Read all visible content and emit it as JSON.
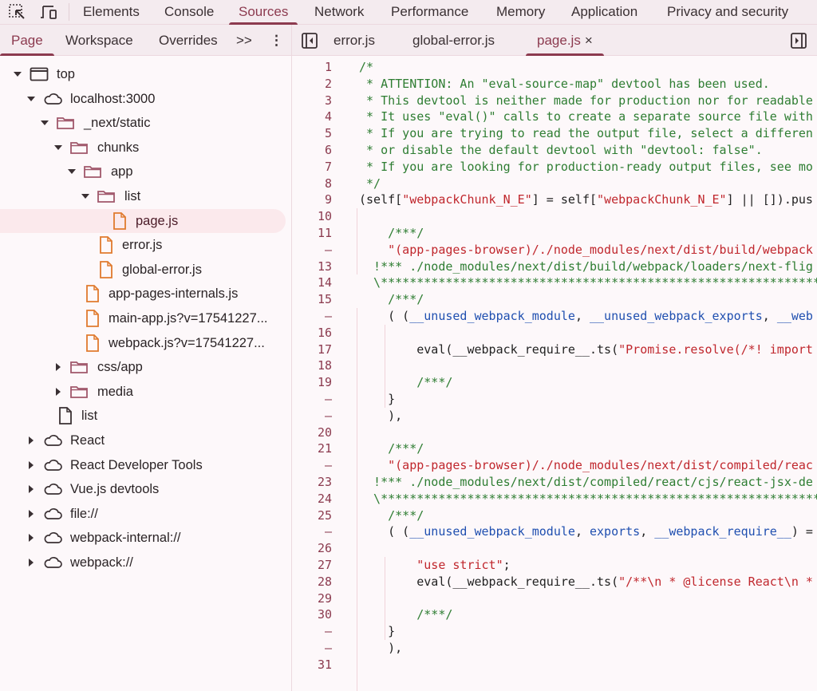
{
  "top_tabs": [
    "Elements",
    "Console",
    "Sources",
    "Network",
    "Performance",
    "Memory",
    "Application",
    "Privacy and security"
  ],
  "top_active": "Sources",
  "nav_tabs": [
    "Page",
    "Workspace",
    "Overrides"
  ],
  "nav_more": ">>",
  "nav_menu": "⋮",
  "editor_tabs": [
    {
      "label": "error.js"
    },
    {
      "label": "global-error.js"
    },
    {
      "label": "page.js",
      "active": true,
      "close": "×"
    }
  ],
  "colors": {
    "accent": "#8c3a4f",
    "comment": "#2e7d32",
    "string": "#c0272d",
    "identifier": "#1f4fb0",
    "folder": "#a0576b",
    "file": "#e07a2e"
  },
  "tree": [
    {
      "label": "top",
      "level": 0,
      "icon": "frame",
      "state": "open"
    },
    {
      "label": "localhost:3000",
      "level": 1,
      "icon": "cloud",
      "state": "open"
    },
    {
      "label": "_next/static",
      "level": 2,
      "icon": "folder",
      "state": "open"
    },
    {
      "label": "chunks",
      "level": 3,
      "icon": "folder",
      "state": "open"
    },
    {
      "label": "app",
      "level": 4,
      "icon": "folder",
      "state": "open"
    },
    {
      "label": "list",
      "level": 5,
      "icon": "folder",
      "state": "open"
    },
    {
      "label": "page.js",
      "level": 6,
      "icon": "file-js",
      "selected": true
    },
    {
      "label": "error.js",
      "level": 5,
      "icon": "file-js"
    },
    {
      "label": "global-error.js",
      "level": 5,
      "icon": "file-js"
    },
    {
      "label": "app-pages-internals.js",
      "level": 4,
      "icon": "file-js"
    },
    {
      "label": "main-app.js?v=17541227...",
      "level": 4,
      "icon": "file-js"
    },
    {
      "label": "webpack.js?v=17541227...",
      "level": 4,
      "icon": "file-js"
    },
    {
      "label": "css/app",
      "level": 3,
      "icon": "folder",
      "state": "closed"
    },
    {
      "label": "media",
      "level": 3,
      "icon": "folder",
      "state": "closed"
    },
    {
      "label": "list",
      "level": 2,
      "icon": "file"
    },
    {
      "label": "React",
      "level": 1,
      "icon": "cloud",
      "state": "closed"
    },
    {
      "label": "React Developer Tools",
      "level": 1,
      "icon": "cloud",
      "state": "closed"
    },
    {
      "label": "Vue.js devtools",
      "level": 1,
      "icon": "cloud",
      "state": "closed"
    },
    {
      "label": "file://",
      "level": 1,
      "icon": "cloud",
      "state": "closed"
    },
    {
      "label": "webpack-internal://",
      "level": 1,
      "icon": "cloud",
      "state": "closed"
    },
    {
      "label": "webpack://",
      "level": 1,
      "icon": "cloud",
      "state": "closed"
    }
  ],
  "code": [
    {
      "n": "1",
      "t": [
        [
          "c",
          "/*"
        ]
      ]
    },
    {
      "n": "2",
      "t": [
        [
          "c",
          " * ATTENTION: An \"eval-source-map\" devtool has been used."
        ]
      ]
    },
    {
      "n": "3",
      "t": [
        [
          "c",
          " * This devtool is neither made for production nor for readable"
        ]
      ]
    },
    {
      "n": "4",
      "t": [
        [
          "c",
          " * It uses \"eval()\" calls to create a separate source file with"
        ]
      ]
    },
    {
      "n": "5",
      "t": [
        [
          "c",
          " * If you are trying to read the output file, select a differen"
        ]
      ]
    },
    {
      "n": "6",
      "t": [
        [
          "c",
          " * or disable the default devtool with \"devtool: false\"."
        ]
      ]
    },
    {
      "n": "7",
      "t": [
        [
          "c",
          " * If you are looking for production-ready output files, see mo"
        ]
      ]
    },
    {
      "n": "8",
      "t": [
        [
          "c",
          " */"
        ]
      ]
    },
    {
      "n": "9",
      "t": [
        [
          "",
          "(self["
        ],
        [
          "s",
          "\"webpackChunk_N_E\""
        ],
        [
          "",
          "] = self["
        ],
        [
          "s",
          "\"webpackChunk_N_E\""
        ],
        [
          "",
          "] || []).pus"
        ]
      ]
    },
    {
      "n": "10",
      "t": []
    },
    {
      "n": "11",
      "t": [
        [
          "c",
          "    /***/"
        ]
      ]
    },
    {
      "n": "–",
      "t": [
        [
          "s",
          "    \"(app-pages-browser)/./node_modules/next/dist/build/webpack"
        ]
      ]
    },
    {
      "n": "13",
      "t": [
        [
          "c",
          "  !*** ./node_modules/next/dist/build/webpack/loaders/next-flig"
        ]
      ]
    },
    {
      "n": "14",
      "t": [
        [
          "c",
          "  \\*************************************************************"
        ]
      ]
    },
    {
      "n": "15",
      "t": [
        [
          "c",
          "    /***/"
        ]
      ]
    },
    {
      "n": "–",
      "t": [
        [
          "",
          "    ( ("
        ],
        [
          "b",
          "__unused_webpack_module"
        ],
        [
          "",
          ", "
        ],
        [
          "b",
          "__unused_webpack_exports"
        ],
        [
          "",
          ", "
        ],
        [
          "b",
          "__web"
        ]
      ]
    },
    {
      "n": "16",
      "t": []
    },
    {
      "n": "17",
      "t": [
        [
          "",
          "        eval(__webpack_require__.ts("
        ],
        [
          "s",
          "\"Promise.resolve(/*! import"
        ]
      ]
    },
    {
      "n": "18",
      "t": []
    },
    {
      "n": "19",
      "t": [
        [
          "c",
          "        /***/"
        ]
      ]
    },
    {
      "n": "–",
      "t": [
        [
          "",
          "    }"
        ]
      ]
    },
    {
      "n": "–",
      "t": [
        [
          "",
          "    ),"
        ]
      ]
    },
    {
      "n": "20",
      "t": []
    },
    {
      "n": "21",
      "t": [
        [
          "c",
          "    /***/"
        ]
      ]
    },
    {
      "n": "–",
      "t": [
        [
          "s",
          "    \"(app-pages-browser)/./node_modules/next/dist/compiled/reac"
        ]
      ]
    },
    {
      "n": "23",
      "t": [
        [
          "c",
          "  !*** ./node_modules/next/dist/compiled/react/cjs/react-jsx-de"
        ]
      ]
    },
    {
      "n": "24",
      "t": [
        [
          "c",
          "  \\*************************************************************"
        ]
      ]
    },
    {
      "n": "25",
      "t": [
        [
          "c",
          "    /***/"
        ]
      ]
    },
    {
      "n": "–",
      "t": [
        [
          "",
          "    ( ("
        ],
        [
          "b",
          "__unused_webpack_module"
        ],
        [
          "",
          ", "
        ],
        [
          "b",
          "exports"
        ],
        [
          "",
          ", "
        ],
        [
          "b",
          "__webpack_require__"
        ],
        [
          "",
          ") ="
        ]
      ]
    },
    {
      "n": "26",
      "t": []
    },
    {
      "n": "27",
      "t": [
        [
          "s",
          "        \"use strict\""
        ],
        [
          "",
          ";"
        ]
      ]
    },
    {
      "n": "28",
      "t": [
        [
          "",
          "        eval(__webpack_require__.ts("
        ],
        [
          "s",
          "\"/**\\n * @license React\\n *"
        ]
      ]
    },
    {
      "n": "29",
      "t": []
    },
    {
      "n": "30",
      "t": [
        [
          "c",
          "        /***/"
        ]
      ]
    },
    {
      "n": "–",
      "t": [
        [
          "",
          "    }"
        ]
      ]
    },
    {
      "n": "–",
      "t": [
        [
          "",
          "    ),"
        ]
      ]
    },
    {
      "n": "31",
      "t": []
    }
  ]
}
